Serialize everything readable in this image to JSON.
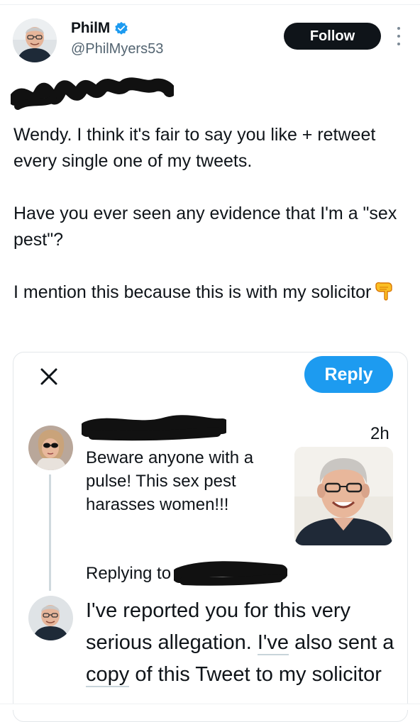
{
  "author": {
    "display_name": "PhilM",
    "handle": "@PhilMyers53",
    "verified": true
  },
  "follow_label": "Follow",
  "tweet_paragraphs": [
    "Wendy. I think it's fair to say you like + retweet every single one of my tweets.",
    "Have you ever seen any evidence that I'm a \"sex pest\"?",
    "I mention this because this is with my solicitor"
  ],
  "embedded_screenshot": {
    "reply_label": "Reply",
    "quoted_tweet": {
      "time": "2h",
      "text": "Beware anyone with a pulse! This sex pest harasses women!!!"
    },
    "replying_to_label": "Replying to",
    "reply_text_parts": [
      "I've reported you for this very serious allegation. ",
      "I've",
      " also sent a ",
      "copy",
      " of this Tweet to my solicitor"
    ]
  },
  "icons": {
    "verified": "verified-badge-icon",
    "more": "more-options-icon",
    "hand": "backhand-index-pointing-down-emoji",
    "close": "close-icon"
  },
  "colors": {
    "accent": "#1d9bf0",
    "follow_bg": "#0f1419",
    "secondary_text": "#536471"
  }
}
